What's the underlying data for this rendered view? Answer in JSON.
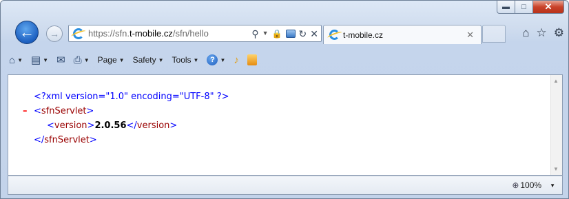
{
  "window": {
    "minimize_icon": "minimize-icon",
    "maximize_icon": "maximize-icon",
    "close_icon": "close-icon"
  },
  "address_bar": {
    "url_scheme": "https://sfn.",
    "url_host": "t-mobile.cz",
    "url_path": "/sfn/hello"
  },
  "tab": {
    "label": "t-mobile.cz"
  },
  "command_bar": {
    "page_label": "Page",
    "safety_label": "Safety",
    "tools_label": "Tools"
  },
  "document": {
    "xml_declaration": "<?xml version=\"1.0\" encoding=\"UTF-8\" ?>",
    "collapse_marker": "–",
    "root_open_tag": "sfnServlet",
    "child_tag": "version",
    "child_value": "2.0.56",
    "root_close_tag": "sfnServlet"
  },
  "status_bar": {
    "zoom": "100%"
  },
  "colors": {
    "declaration": "#0000ff",
    "tag_name": "#990000",
    "collapse_marker": "#ff0000",
    "close_button": "#c9432a"
  }
}
